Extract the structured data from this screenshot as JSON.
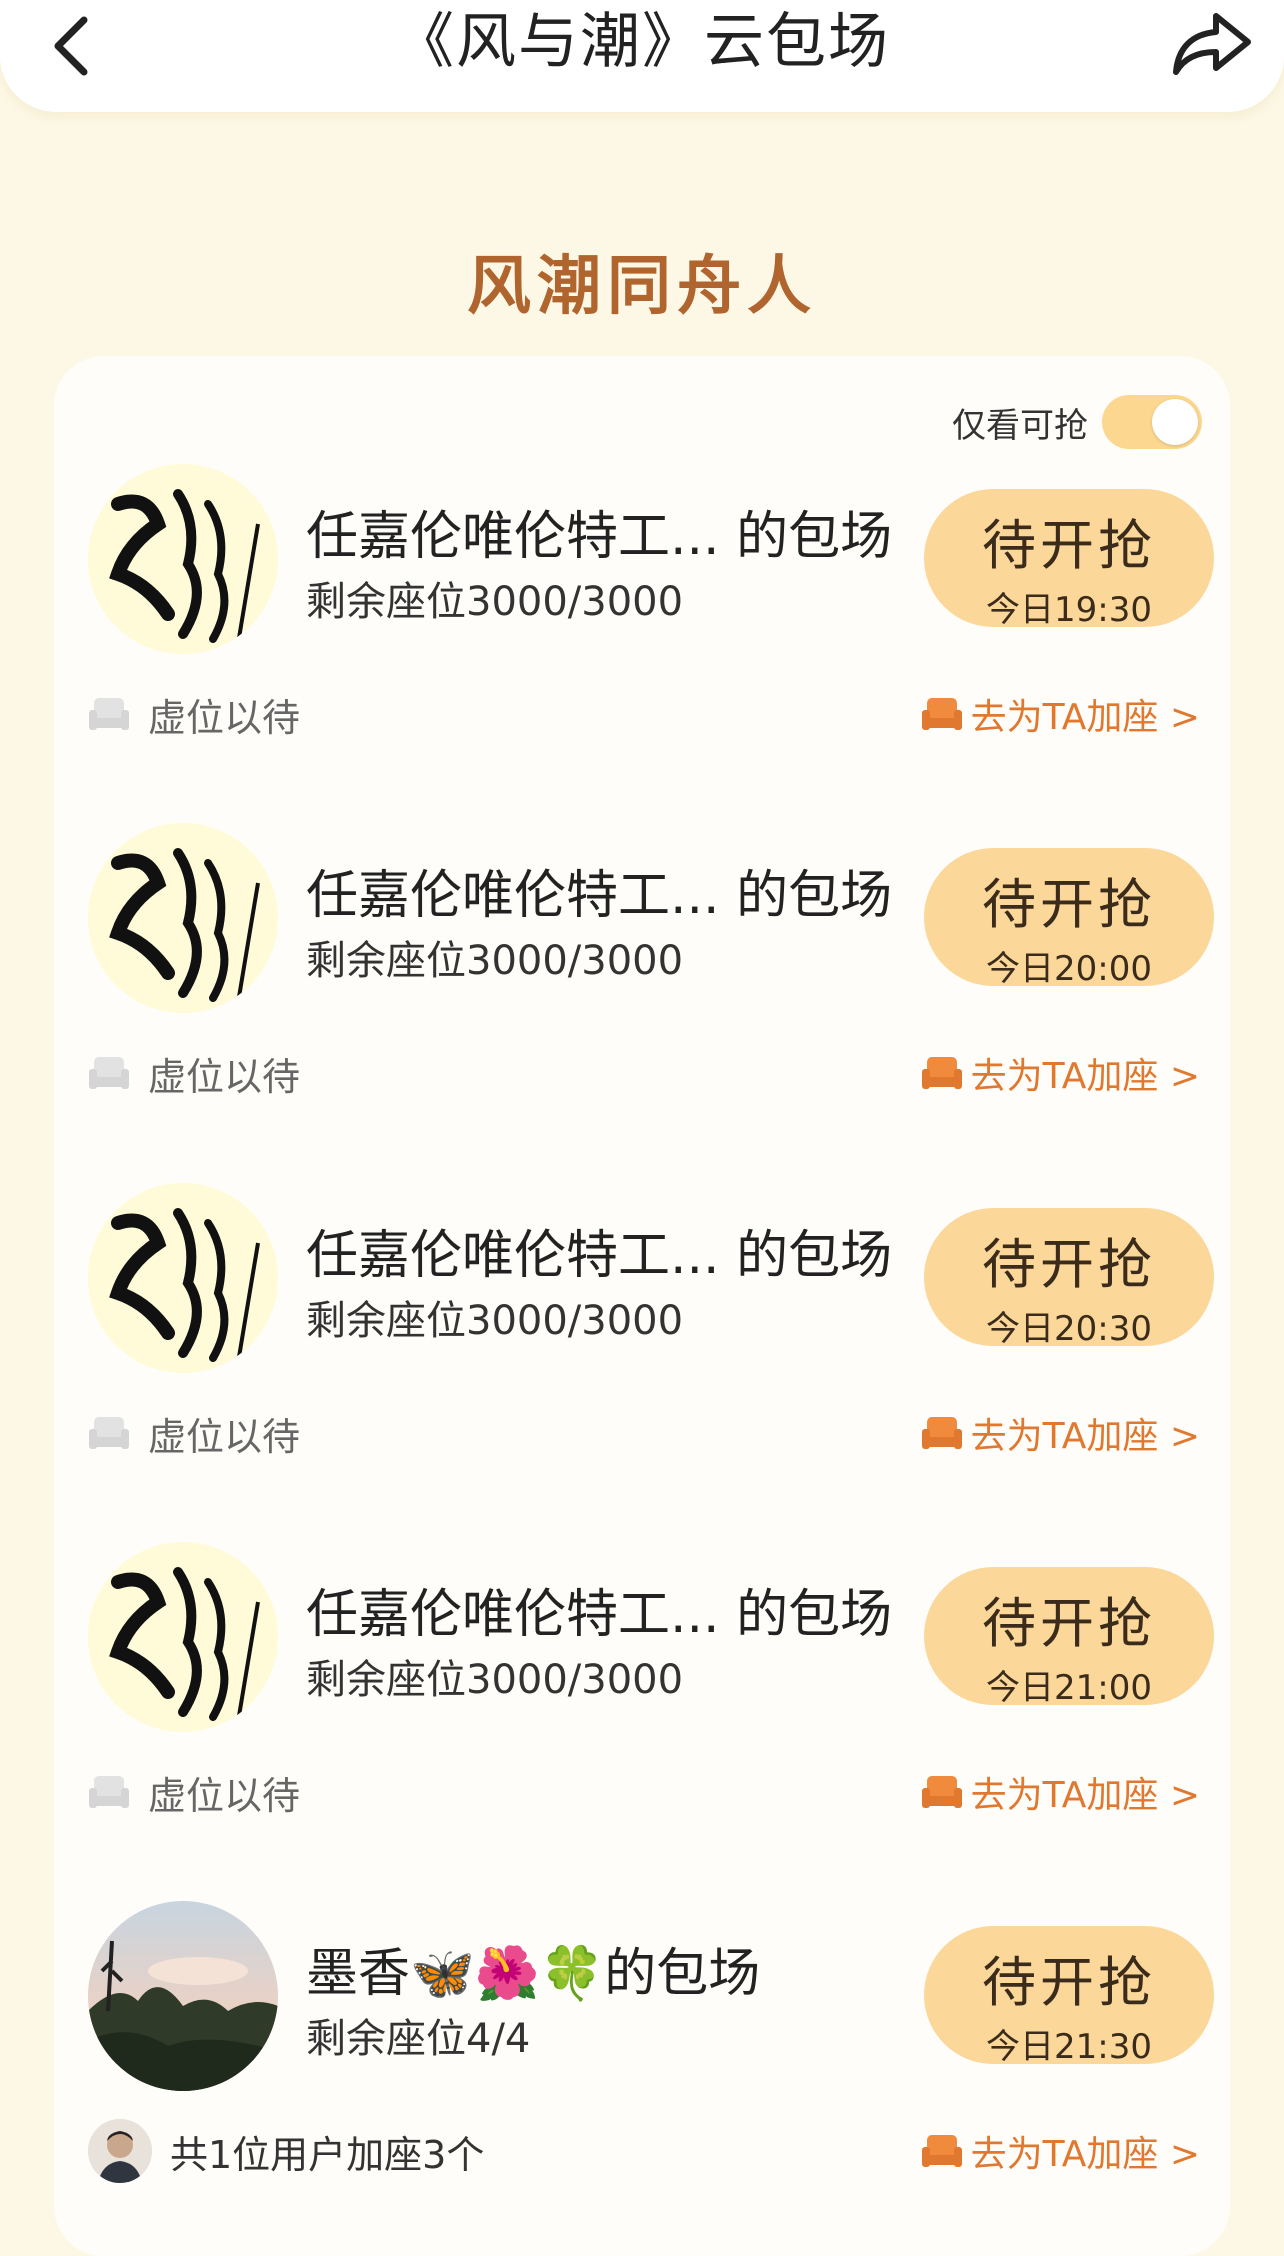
{
  "header": {
    "title": "《风与潮》云包场",
    "back_icon": "chevron-left-icon",
    "share_icon": "share-icon"
  },
  "section_title": "风潮同舟人",
  "filter": {
    "label": "仅看可抢",
    "toggle_on": true
  },
  "colors": {
    "background": "#fdf8e6",
    "accent_orange": "#e0792f",
    "button_fill": "#fcd79a",
    "section_title": "#b0652f"
  },
  "sessions": [
    {
      "title": "任嘉伦唯伦特工... 的包场",
      "seats": "剩余座位3000/3000",
      "button_label": "待开抢",
      "time": "今日19:30",
      "footer_left": "虚位以待",
      "add_seat": "去为TA加座 >"
    },
    {
      "title": "任嘉伦唯伦特工... 的包场",
      "seats": "剩余座位3000/3000",
      "button_label": "待开抢",
      "time": "今日20:00",
      "footer_left": "虚位以待",
      "add_seat": "去为TA加座 >"
    },
    {
      "title": "任嘉伦唯伦特工... 的包场",
      "seats": "剩余座位3000/3000",
      "button_label": "待开抢",
      "time": "今日20:30",
      "footer_left": "虚位以待",
      "add_seat": "去为TA加座 >"
    },
    {
      "title": "任嘉伦唯伦特工... 的包场",
      "seats": "剩余座位3000/3000",
      "button_label": "待开抢",
      "time": "今日21:00",
      "footer_left": "虚位以待",
      "add_seat": "去为TA加座 >"
    },
    {
      "title": "墨香🦋🌺🍀的包场",
      "seats": "剩余座位4/4",
      "button_label": "待开抢",
      "time": "今日21:30",
      "footer_left": "共1位用户加座3个",
      "add_seat": "去为TA加座 >"
    }
  ]
}
